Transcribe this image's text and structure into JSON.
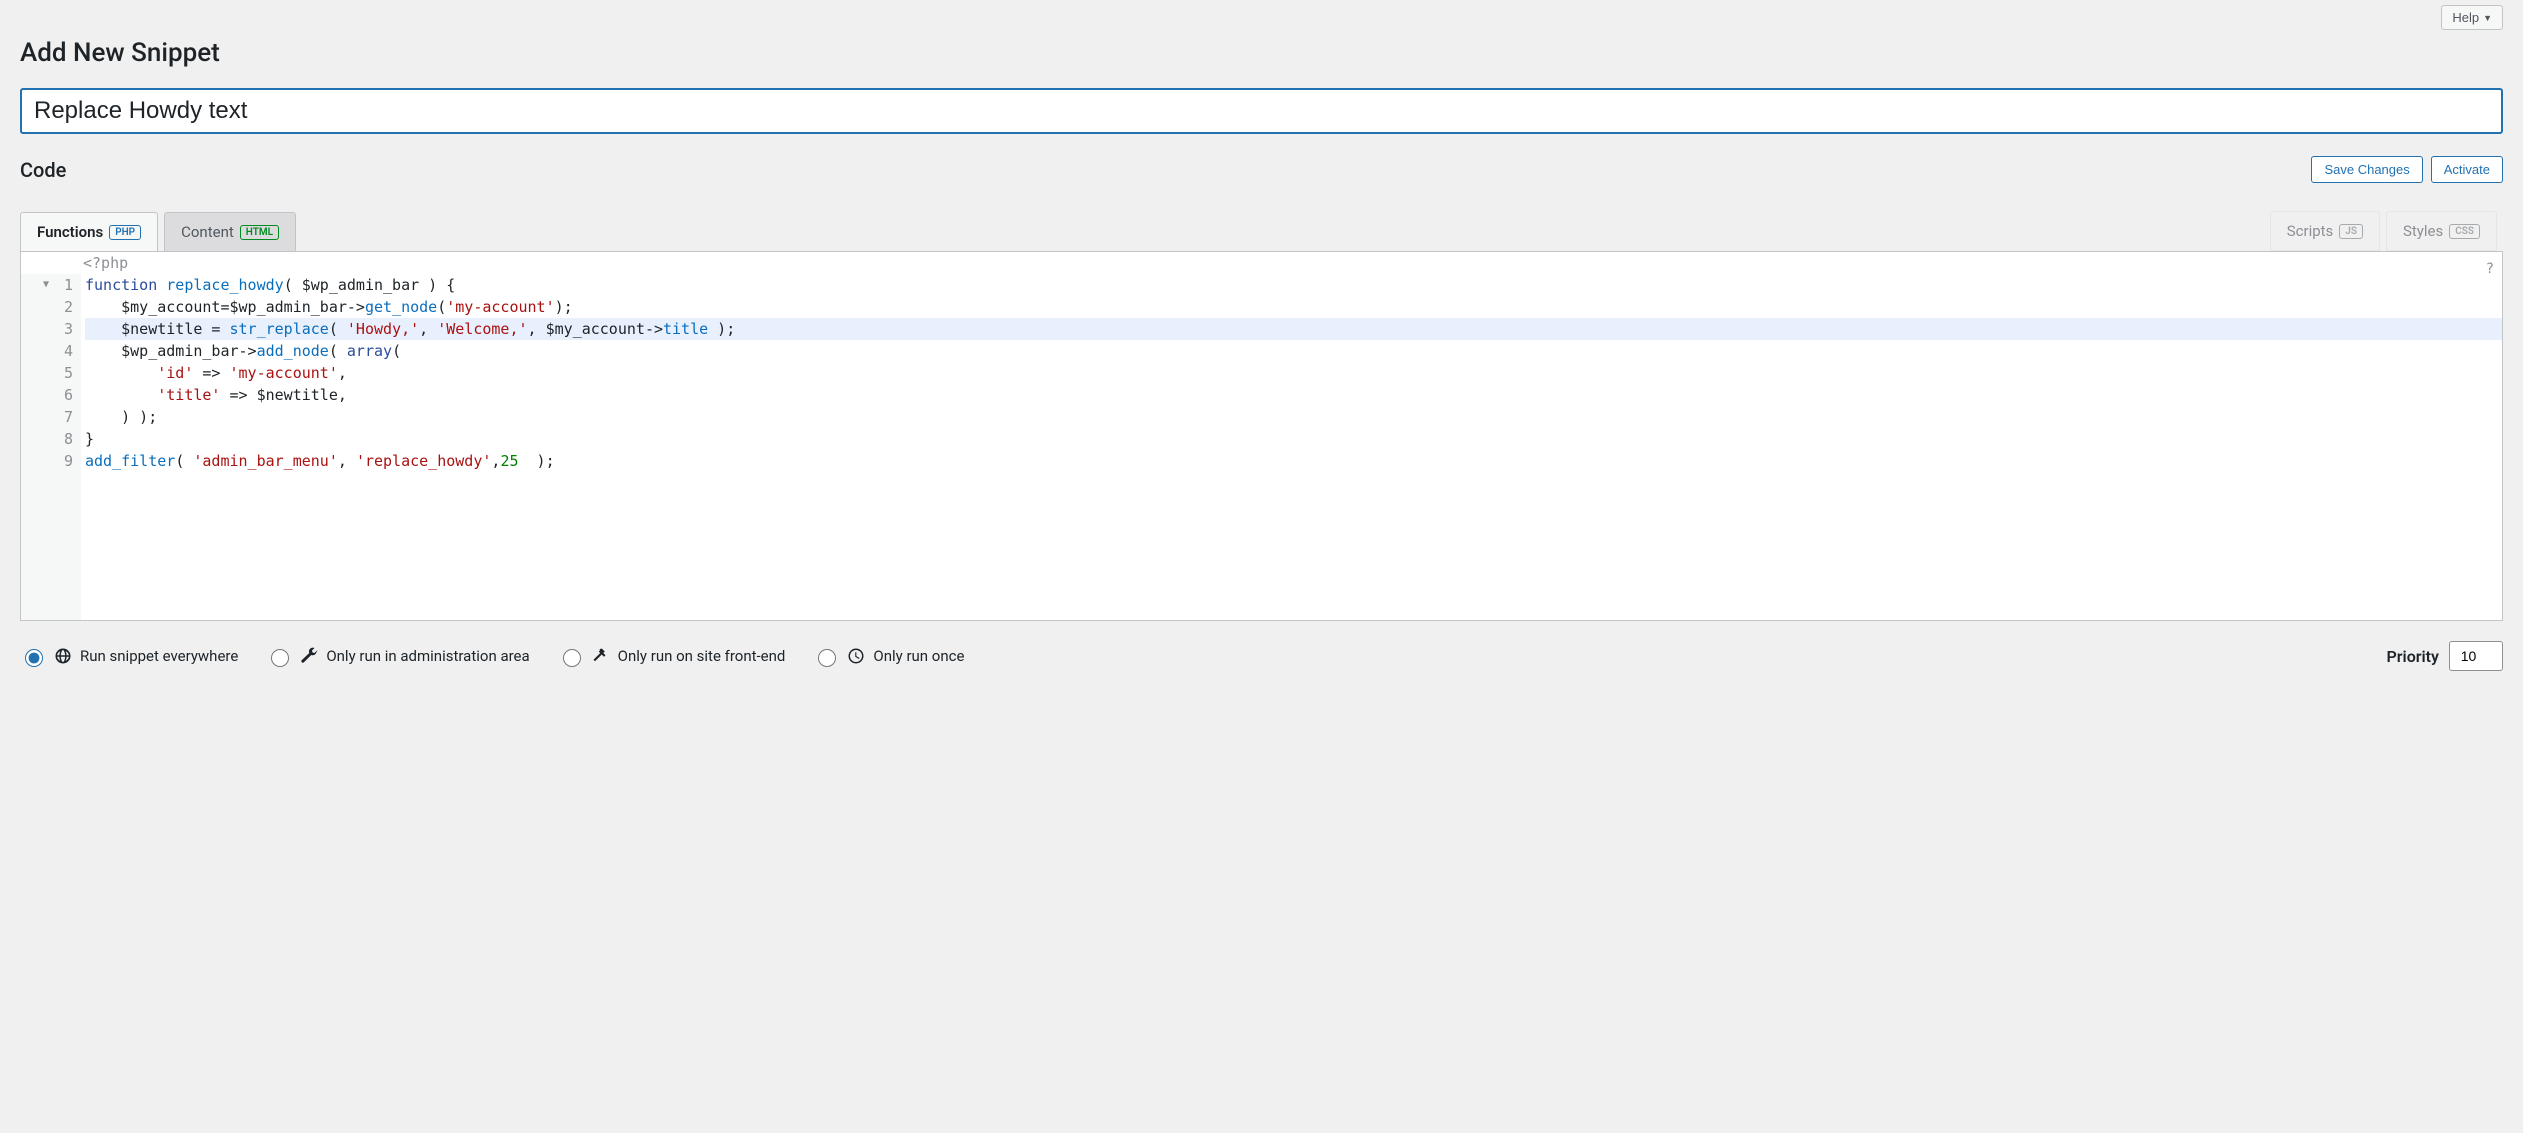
{
  "help_label": "Help",
  "page_title": "Add New Snippet",
  "title_value": "Replace Howdy text",
  "code_heading": "Code",
  "buttons": {
    "save": "Save Changes",
    "activate": "Activate"
  },
  "tabs": {
    "functions": {
      "label": "Functions",
      "badge": "PHP"
    },
    "content": {
      "label": "Content",
      "badge": "HTML"
    },
    "scripts": {
      "label": "Scripts",
      "badge": "JS"
    },
    "styles": {
      "label": "Styles",
      "badge": "CSS"
    }
  },
  "editor": {
    "prefix": "<?php",
    "help_tip": "?",
    "line_numbers": [
      "1",
      "2",
      "3",
      "4",
      "5",
      "6",
      "7",
      "8",
      "9"
    ],
    "fold_marker": "▼",
    "highlighted_line": 3,
    "lines_html": [
      "<span class='kw'>function</span> <span class='ident'>replace_howdy</span>( <span class='var'>$wp_admin_bar</span> ) {",
      "    <span class='var'>$my_account</span>=<span class='var'>$wp_admin_bar</span>-><span class='ident'>get_node</span>(<span class='str'>'my-account'</span>);",
      "    <span class='var'>$newtitle</span> = <span class='ident'>str_replace</span>( <span class='str'>'Howdy,'</span>, <span class='str'>'Welcome,'</span>, <span class='var'>$my_account</span>-><span class='ident'>title</span> );",
      "    <span class='var'>$wp_admin_bar</span>-><span class='ident'>add_node</span>( <span class='kw'>array</span>(",
      "        <span class='str'>'id'</span> => <span class='str'>'my-account'</span>,",
      "        <span class='str'>'title'</span> => <span class='var'>$newtitle</span>,",
      "    ) );",
      "}",
      "<span class='ident'>add_filter</span>( <span class='str'>'admin_bar_menu'</span>, <span class='str'>'replace_howdy'</span>,<span class='num'>25</span>  );"
    ]
  },
  "scope": {
    "everywhere": "Run snippet everywhere",
    "admin": "Only run in administration area",
    "frontend": "Only run on site front-end",
    "once": "Only run once",
    "selected": "everywhere"
  },
  "priority": {
    "label": "Priority",
    "value": "10"
  }
}
